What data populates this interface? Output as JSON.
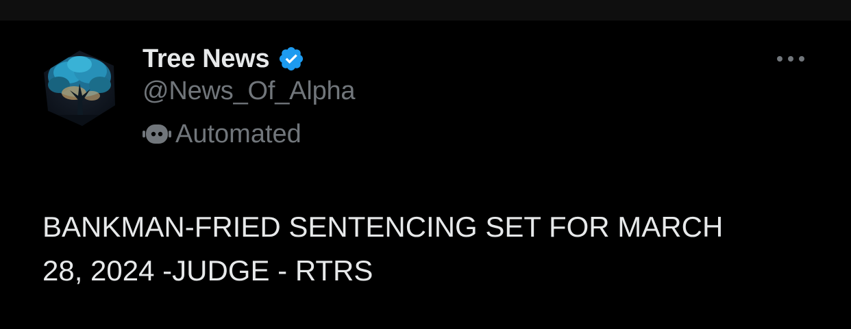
{
  "tweet": {
    "author": {
      "display_name": "Tree News",
      "handle": "@News_Of_Alpha",
      "verified": true,
      "avatar_icon": "tree-avatar",
      "automated_label": "Automated",
      "automated_icon": "bot-icon"
    },
    "more_icon": "more-options-icon",
    "text": "BANKMAN-FRIED SENTENCING SET FOR MARCH\n28, 2024 -JUDGE - RTRS"
  },
  "colors": {
    "background": "#000000",
    "primary_text": "#e7e9ea",
    "secondary_text": "#71767b",
    "verified_badge": "#1d9bf0"
  }
}
